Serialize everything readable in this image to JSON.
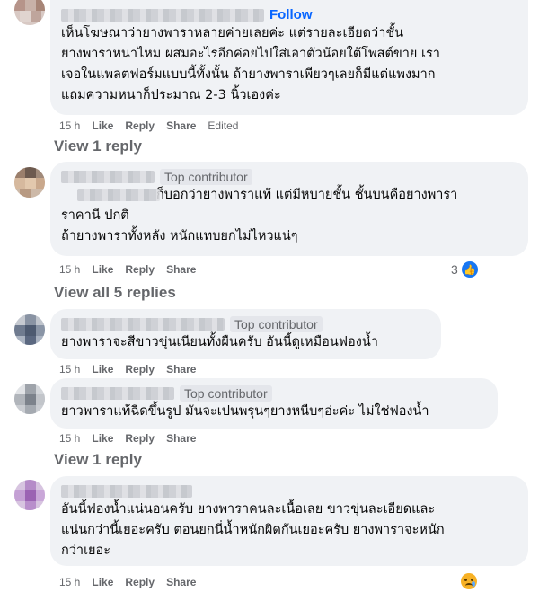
{
  "comments": [
    {
      "badge": "",
      "follow": "Follow",
      "text": "เห็นโฆษณาว่ายางพาราหลายค่ายเลยค่ะ แต่รายละเอียดว่าชั้น\nยางพาราหนาไหม ผสมอะไรอีกค่อยไปใส่เอาตัวน้อยใต้โพสต์ขาย เรา\nเจอในแพลตฟอร์มแบบนี้ทั้งนั้น ถ้ายางพาราเพียวๆเลยก็มีแต่แพงมาก\nแถมความหนาก็ประมาณ 2-3 นิ้วเองค่ะ",
      "time": "15 h",
      "like": "Like",
      "reply": "Reply",
      "share": "Share",
      "edited": "Edited"
    },
    {
      "badge": "Top contributor",
      "text": "ก็บอกว่ายางพาราแท้ แต่มีหบายชั้น ชั้นบนคือยางพารา\nราคานี ปกติ\nถ้ายางพาราทั้งหลัง หนักแทบยกไม่ไหวแน่ๆ",
      "time": "15 h",
      "like": "Like",
      "reply": "Reply",
      "share": "Share",
      "reaction_count": "3"
    },
    {
      "badge": "Top contributor",
      "text": "ยางพาราจะสีขาวขุ่นเนียนทั้งผืนครับ อันนี้ดูเหมือนฟองน้ำ",
      "time": "15 h",
      "like": "Like",
      "reply": "Reply",
      "share": "Share"
    },
    {
      "badge": "Top contributor",
      "text": "ยาวพาราแท้ฉีดขึ้นรูป มันจะเปนพรุนๆยางหนืบๆอ่ะค่ะ ไม่ใช่ฟองน้ำ",
      "time": "15 h",
      "like": "Like",
      "reply": "Reply",
      "share": "Share"
    },
    {
      "badge": "",
      "text": "อันนี้ฟองน้ำแน่นอนครับ ยางพาราคนละเนื้อเลย ขาวขุ่นละเอียดและ\nแน่นกว่านี้เยอะครับ ตอนยกนี่น้ำหนักผิดกันเยอะครับ ยางพาราจะหนัก\nกว่าเยอะ",
      "time": "15 h",
      "like": "Like",
      "reply": "Reply",
      "share": "Share"
    }
  ],
  "view_replies": [
    "View 1 reply",
    "View all 5 replies",
    "View 1 reply"
  ],
  "icons": {
    "like_reaction": "like-thumb-icon",
    "sad_reaction": "sad-face-icon"
  },
  "colors": {
    "bubble": "#f0f2f5",
    "follow": "#0866ff",
    "meta": "#65676b",
    "like": "#1877f2"
  }
}
